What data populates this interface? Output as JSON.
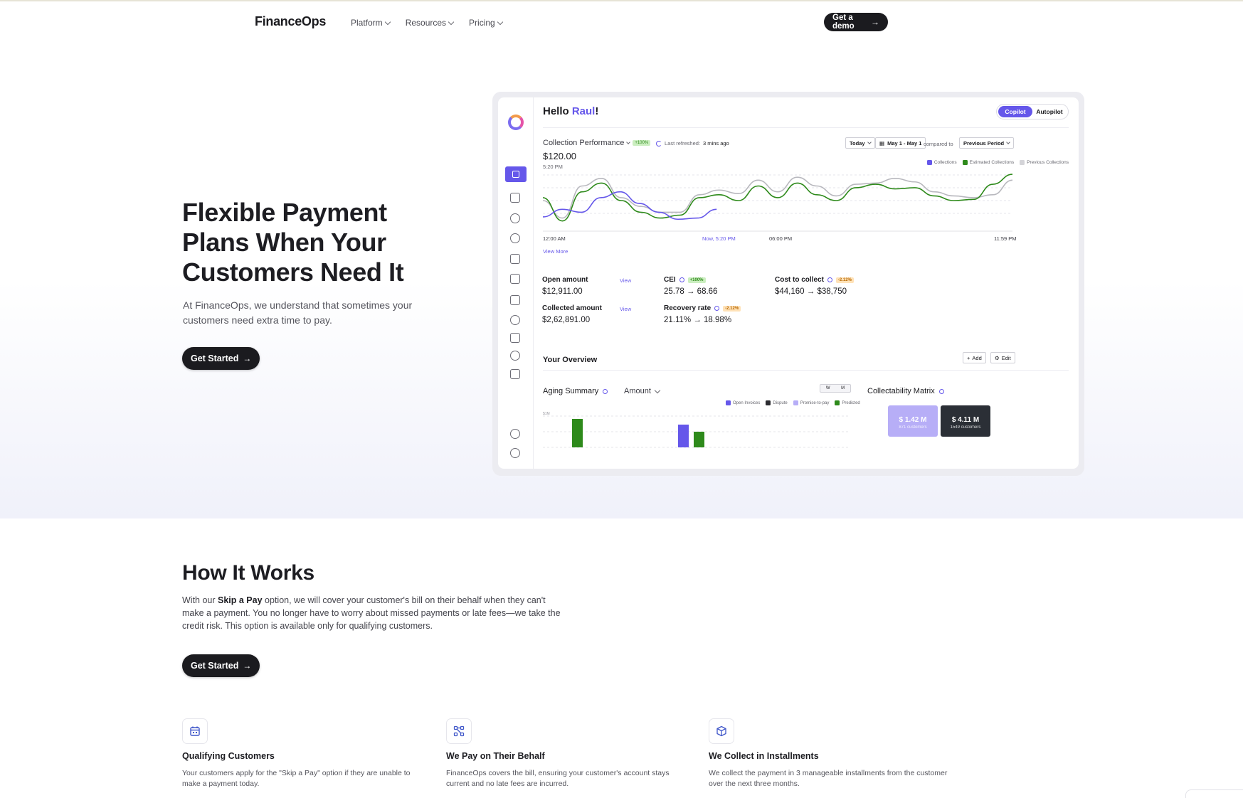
{
  "nav": {
    "logo": "FinanceOps",
    "links": [
      "Platform",
      "Resources",
      "Pricing"
    ],
    "cta": "Get a demo"
  },
  "hero": {
    "title": "Flexible Payment Plans When Your Customers Need It",
    "subtitle": "At FinanceOps, we understand that sometimes your customers need extra time to pay.",
    "cta": "Get Started"
  },
  "dashboard": {
    "greeting": "Hello ",
    "user": "Raul",
    "greeting_end": "!",
    "mode_toggle": [
      "Copilot",
      "Autopilot"
    ],
    "collection": {
      "title": "Collection Performance",
      "badge": "+100%",
      "refresh_label": "Last refreshed:",
      "refresh_value": "3 mins ago",
      "amount": "$120.00",
      "time": "5:20 PM",
      "controls": {
        "period": "Today",
        "range": "May 1 - May 1",
        "compared_to": "compared to",
        "compare_period": "Previous Period"
      },
      "view_more": "View More"
    },
    "chart_data": {
      "type": "line",
      "x_labels": [
        "12:00 AM",
        "Now, 5:20 PM",
        "06:00 PM",
        "11:59 PM"
      ],
      "series": [
        {
          "name": "Collections",
          "color": "#6557ea",
          "values": [
            0.22,
            0.35,
            0.3,
            0.55,
            0.65,
            0.45,
            0.3,
            0.18,
            0.2,
            0.35
          ]
        },
        {
          "name": "Estimated Collections",
          "color": "#2e8a1b",
          "values": [
            0.55,
            0.15,
            0.65,
            0.8,
            0.5,
            0.3,
            0.2,
            0.25,
            0.55,
            0.6,
            0.5,
            0.75,
            0.55,
            0.8,
            0.6,
            0.5,
            0.72,
            0.78,
            0.7,
            0.72,
            0.58,
            0.5,
            0.52,
            0.78,
            0.95
          ]
        },
        {
          "name": "Previous Collections",
          "color": "#b8b8be",
          "values": [
            0.5,
            0.2,
            0.75,
            0.88,
            0.55,
            0.4,
            0.3,
            0.3,
            0.6,
            0.68,
            0.62,
            0.85,
            0.65,
            0.9,
            0.75,
            0.58,
            0.78,
            0.8,
            0.88,
            0.82,
            0.65,
            0.58,
            0.55,
            0.6,
            0.85
          ]
        }
      ]
    },
    "metrics": {
      "open_amount": {
        "label": "Open amount",
        "value": "$12,911.00",
        "link": "View"
      },
      "collected_amount": {
        "label": "Collected amount",
        "value": "$2,62,891.00",
        "link": "View"
      },
      "cei": {
        "label": "CEI",
        "badge": "+100%",
        "value": "25.78 → 68.66"
      },
      "recovery_rate": {
        "label": "Recovery rate",
        "badge": "-2.12%",
        "value": "21.11% → 18.98%"
      },
      "cost_to_collect": {
        "label": "Cost to collect",
        "badge": "-2.12%",
        "value": "$44,160 → $38,750"
      }
    },
    "overview": {
      "title": "Your Overview",
      "add": "Add",
      "edit": "Edit"
    },
    "aging": {
      "title": "Aging Summary",
      "dropdown": "Amount",
      "toggle": [
        "W",
        "M"
      ],
      "legend": [
        {
          "name": "Open Invoices",
          "color": "#6557ea"
        },
        {
          "name": "Dispute",
          "color": "#2b2b30"
        },
        {
          "name": "Promise-to-pay",
          "color": "#b7aef7"
        },
        {
          "name": "Predicted",
          "color": "#2e8a1b"
        }
      ],
      "y_tick": "$1M"
    },
    "collectability": {
      "title": "Collectability Matrix",
      "tiles": [
        {
          "value": "$ 1.42 M",
          "sub": "871 customers",
          "color": "#b7aef7"
        },
        {
          "value": "$ 4.11 M",
          "sub": "1549 customers",
          "color": "#2b2f36"
        }
      ]
    }
  },
  "how_it_works": {
    "title": "How It Works",
    "text_before": "With our ",
    "text_bold": "Skip a Pay",
    "text_after": " option, we will cover your customer's bill on their behalf when they can't make a payment. You no longer have to worry about missed payments or late fees—we take the credit risk. This option is available only for qualifying customers.",
    "cta": "Get Started",
    "steps": [
      {
        "icon": "calendar-icon",
        "title": "Qualifying Customers",
        "desc": "Your customers apply for the \"Skip a Pay\" option if they are unable to make a payment today."
      },
      {
        "icon": "workflow-icon",
        "title": "We Pay on Their Behalf",
        "desc": "FinanceOps covers the bill, ensuring your customer's account stays current and no late fees are incurred."
      },
      {
        "icon": "box-icon",
        "title": "We Collect in Installments",
        "desc": "We collect the payment in 3 manageable installments from the customer over the next three months."
      }
    ]
  },
  "colors": {
    "accent": "#6557ea",
    "dark": "#1b1b1f",
    "green": "#2e8a1b"
  }
}
